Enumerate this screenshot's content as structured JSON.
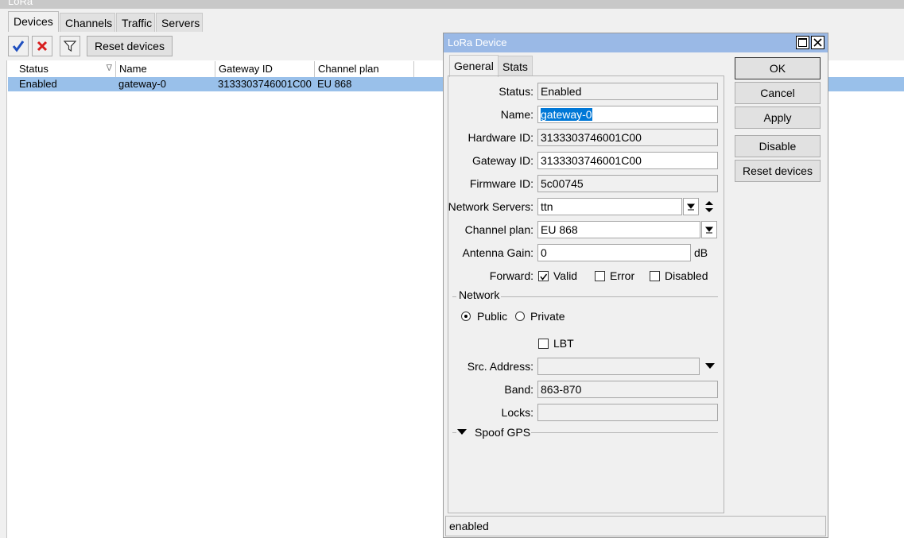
{
  "main": {
    "title": "LoRa",
    "tabs": [
      "Devices",
      "Channels",
      "Traffic",
      "Servers"
    ],
    "toolbar": {
      "reset_label": "Reset devices"
    },
    "columns": [
      "Status",
      "Name",
      "Gateway ID",
      "Channel plan"
    ],
    "rows": [
      {
        "status": "Enabled",
        "name": "gateway-0",
        "gateway_id": "3133303746001C00",
        "channel_plan": "EU 868"
      }
    ]
  },
  "dialog": {
    "title": "LoRa Device",
    "tabs": [
      "General",
      "Stats"
    ],
    "fields": {
      "status_label": "Status:",
      "status": "Enabled",
      "name_label": "Name:",
      "name": "gateway-0",
      "hardware_id_label": "Hardware ID:",
      "hardware_id": "3133303746001C00",
      "gateway_id_label": "Gateway ID:",
      "gateway_id": "3133303746001C00",
      "firmware_id_label": "Firmware ID:",
      "firmware_id": "5c00745",
      "network_servers_label": "Network Servers:",
      "network_servers": "ttn",
      "channel_plan_label": "Channel plan:",
      "channel_plan": "EU 868",
      "antenna_gain_label": "Antenna Gain:",
      "antenna_gain": "0",
      "antenna_unit": "dB",
      "forward_label": "Forward:",
      "fwd_valid": "Valid",
      "fwd_error": "Error",
      "fwd_disabled": "Disabled",
      "network_section": "Network",
      "public": "Public",
      "private": "Private",
      "lbt": "LBT",
      "src_address_label": "Src. Address:",
      "src_address": "",
      "band_label": "Band:",
      "band": "863-870",
      "locks_label": "Locks:",
      "locks": "",
      "spoof_gps": "Spoof GPS"
    },
    "buttons": {
      "ok": "OK",
      "cancel": "Cancel",
      "apply": "Apply",
      "disable": "Disable",
      "reset": "Reset devices"
    },
    "status_bar": "enabled"
  },
  "colors": {
    "selection": "#99c0ea",
    "title_bar": "#9ab9e6",
    "accent": "#0078d7"
  }
}
